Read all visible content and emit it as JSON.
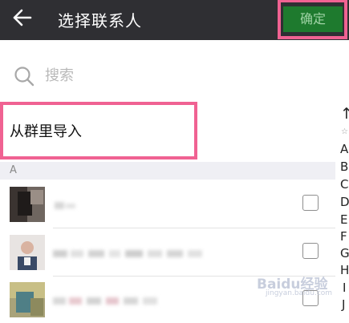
{
  "header": {
    "title": "选择联系人",
    "confirm_label": "确定"
  },
  "search": {
    "placeholder": "搜索"
  },
  "import_from_group": "从群里导入",
  "section": {
    "letter": "A"
  },
  "contacts": [
    {
      "name": ""
    },
    {
      "name": ""
    },
    {
      "name": ""
    }
  ],
  "index_bar": [
    "↑",
    "☆",
    "A",
    "B",
    "C",
    "D",
    "E",
    "F",
    "G",
    "H",
    "I",
    "J"
  ],
  "watermark": {
    "text": "Baidu经验",
    "url": "jingyan.baidu.com"
  },
  "colors": {
    "topbar": "#2f2f33",
    "confirm_bg": "#1e7a2e",
    "highlight": "#f06292",
    "section_bg": "#efeff4"
  }
}
